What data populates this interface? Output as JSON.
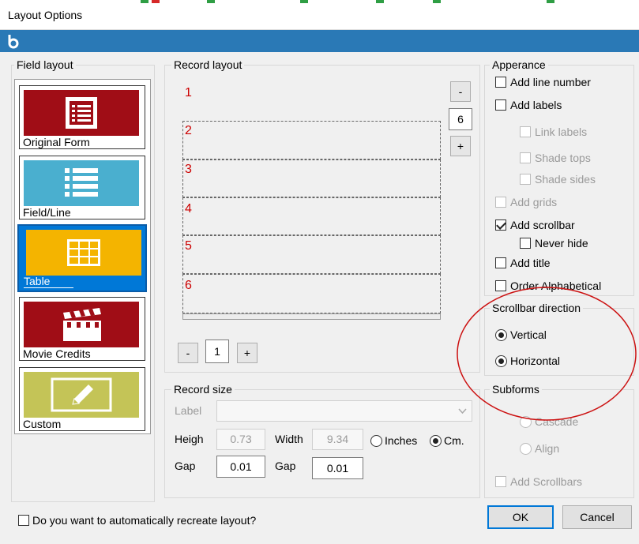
{
  "window": {
    "title": "Layout Options"
  },
  "field_layout": {
    "title": "Field layout",
    "tiles": [
      {
        "label": "Original Form",
        "color": "#a00d16",
        "icon": "form-icon"
      },
      {
        "label": "Field/Line",
        "color": "#4aafcf",
        "icon": "list-icon"
      },
      {
        "label": "Table",
        "color": "#f4b400",
        "icon": "table-icon",
        "selected": true
      },
      {
        "label": "Movie Credits",
        "color": "#a00d16",
        "icon": "clapperboard-icon"
      },
      {
        "label": "Custom",
        "color": "#c4c457",
        "icon": "pencil-icon"
      }
    ]
  },
  "record_layout": {
    "title": "Record layout",
    "rows": [
      "1",
      "2",
      "3",
      "4",
      "5",
      "6"
    ],
    "minus": "-",
    "plus": "+",
    "count": "6",
    "page_minus": "-",
    "page_value": "1",
    "page_plus": "+"
  },
  "appearance": {
    "title": "Apperance",
    "add_line_number": "Add line number",
    "add_labels": "Add labels",
    "link_labels": "Link labels",
    "shade_tops": "Shade tops",
    "shade_sides": "Shade sides",
    "add_grids": "Add grids",
    "add_scrollbar": "Add scrollbar",
    "never_hide": "Never hide",
    "add_title": "Add title",
    "order_alphabetical": "Order Alphabetical"
  },
  "scrollbar_direction": {
    "title": "Scrollbar direction",
    "vertical": "Vertical",
    "horizontal": "Horizontal"
  },
  "subforms": {
    "title": "Subforms",
    "cascade": "Cascade",
    "align": "Align",
    "add_scrollbars": "Add Scrollbars"
  },
  "record_size": {
    "title": "Record size",
    "label_label": "Label",
    "height_label": "Heigh",
    "height_value": "0.73",
    "width_label": "Width",
    "width_value": "9.34",
    "inches": "Inches",
    "cm": "Cm.",
    "gap1_label": "Gap",
    "gap1_value": "0.01",
    "gap2_label": "Gap",
    "gap2_value": "0.01"
  },
  "footer": {
    "recreate_question": "Do you want to automatically recreate layout?",
    "ok": "OK",
    "cancel": "Cancel"
  },
  "annotation_color": "#cc1111"
}
